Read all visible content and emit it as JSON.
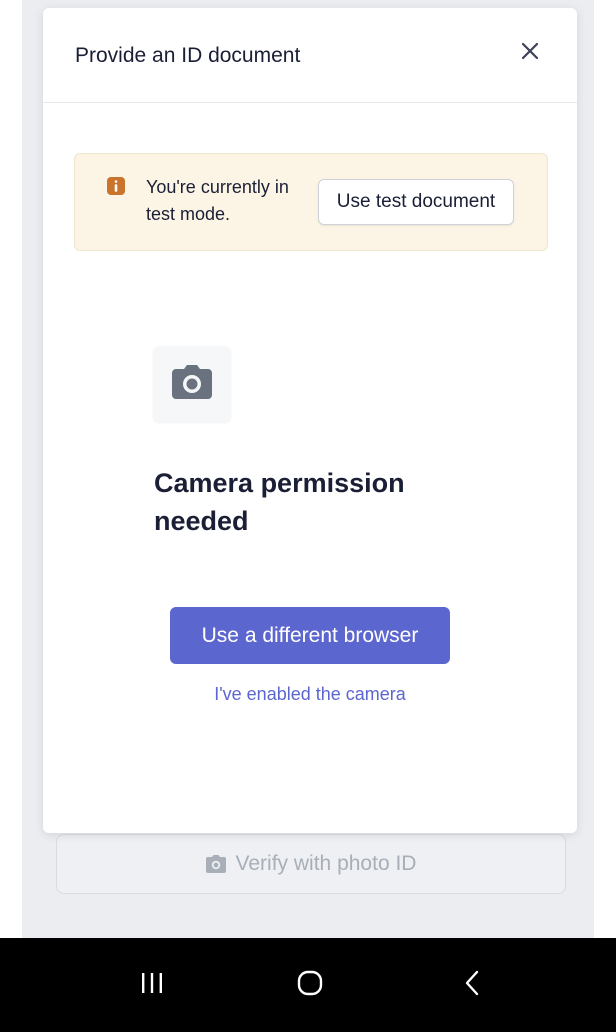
{
  "background": {
    "verify_button_label": "Verify with photo ID"
  },
  "modal": {
    "title": "Provide an ID document",
    "close_label": "×",
    "test_banner": {
      "message": "You're currently in test mode.",
      "button_label": "Use test document"
    },
    "camera": {
      "heading": "Camera permission needed",
      "primary_button_label": "Use a different browser",
      "link_label": "I've enabled the camera"
    }
  },
  "colors": {
    "accent": "#5c66cf",
    "warning_bg": "#fcf5e5",
    "warning_icon": "#c9742a",
    "text": "#1a1f36"
  },
  "icons": {
    "info": "info-icon",
    "camera": "camera-icon",
    "close": "close-icon"
  }
}
